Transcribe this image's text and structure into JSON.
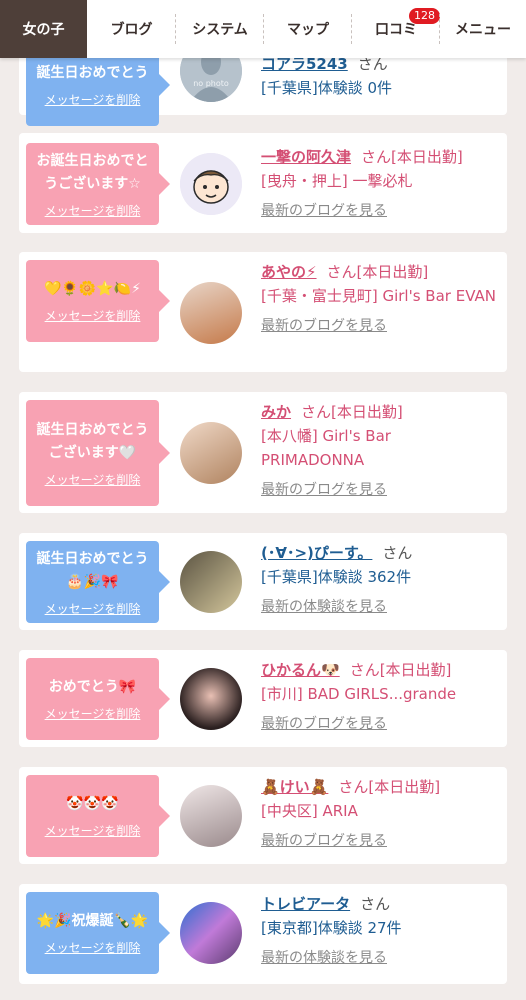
{
  "nav": {
    "items": [
      "女の子",
      "ブログ",
      "システム",
      "マップ",
      "口コミ",
      "メニュー"
    ],
    "badge": "128"
  },
  "cards": [
    {
      "msg": "誕生日おめでとう",
      "del": "メッセージを削除",
      "name": "コアラ5243",
      "san": "さん",
      "sub": "[千葉県]体験談 0件",
      "link": "",
      "color": "blue"
    },
    {
      "msg": "お誕生日おめでとうございます☆",
      "del": "メッセージを削除",
      "name": "一撃の阿久津",
      "san": "さん[本日出勤]",
      "sub": "[曳舟・押上] 一撃必札",
      "link": "最新のブログを見る",
      "color": "pink"
    },
    {
      "msg": "💛🌻🌼⭐🍋⚡",
      "del": "メッセージを削除",
      "name": "あやの⚡",
      "san": "さん[本日出勤]",
      "sub": "[千葉・富士見町] Girl's Bar EVAN",
      "link": "最新のブログを見る",
      "color": "pink"
    },
    {
      "msg": "誕生日おめでとうございます🤍",
      "del": "メッセージを削除",
      "name": "みか",
      "san": "さん[本日出勤]",
      "sub": "[本八幡] Girl's Bar PRIMADONNA",
      "link": "最新のブログを見る",
      "color": "pink"
    },
    {
      "msg": "誕生日おめでとう🎂🎉🎀",
      "del": "メッセージを削除",
      "name": "(･∀･>)ぴーす。",
      "san": "さん",
      "sub": "[千葉県]体験談 362件",
      "link": "最新の体験談を見る",
      "color": "blue"
    },
    {
      "msg": "おめでとう🎀",
      "del": "メッセージを削除",
      "name": "ひかるん🐶",
      "san": "さん[本日出勤]",
      "sub": "[市川] BAD GIRLS...grande",
      "link": "最新のブログを見る",
      "color": "pink"
    },
    {
      "msg": "🤡🤡🤡",
      "del": "メッセージを削除",
      "name": "🧸けい🧸",
      "san": "さん[本日出勤]",
      "sub": "[中央区] ARIA",
      "link": "最新のブログを見る",
      "color": "pink"
    },
    {
      "msg": "🌟🎉祝爆誕🍾🌟",
      "del": "メッセージを削除",
      "name": "トレビアータ",
      "san": "さん",
      "sub": "[東京都]体験談 27件",
      "link": "最新の体験談を見る",
      "color": "blue"
    }
  ],
  "avatar_no_photo": "no photo",
  "colors": {
    "pink_msg": "#f8a2b3",
    "blue_msg": "#7fb2f0",
    "pink_text": "#d44f74",
    "blue_text": "#1f5d92",
    "nav_active": "#4e3f39",
    "badge": "#e01b22"
  }
}
